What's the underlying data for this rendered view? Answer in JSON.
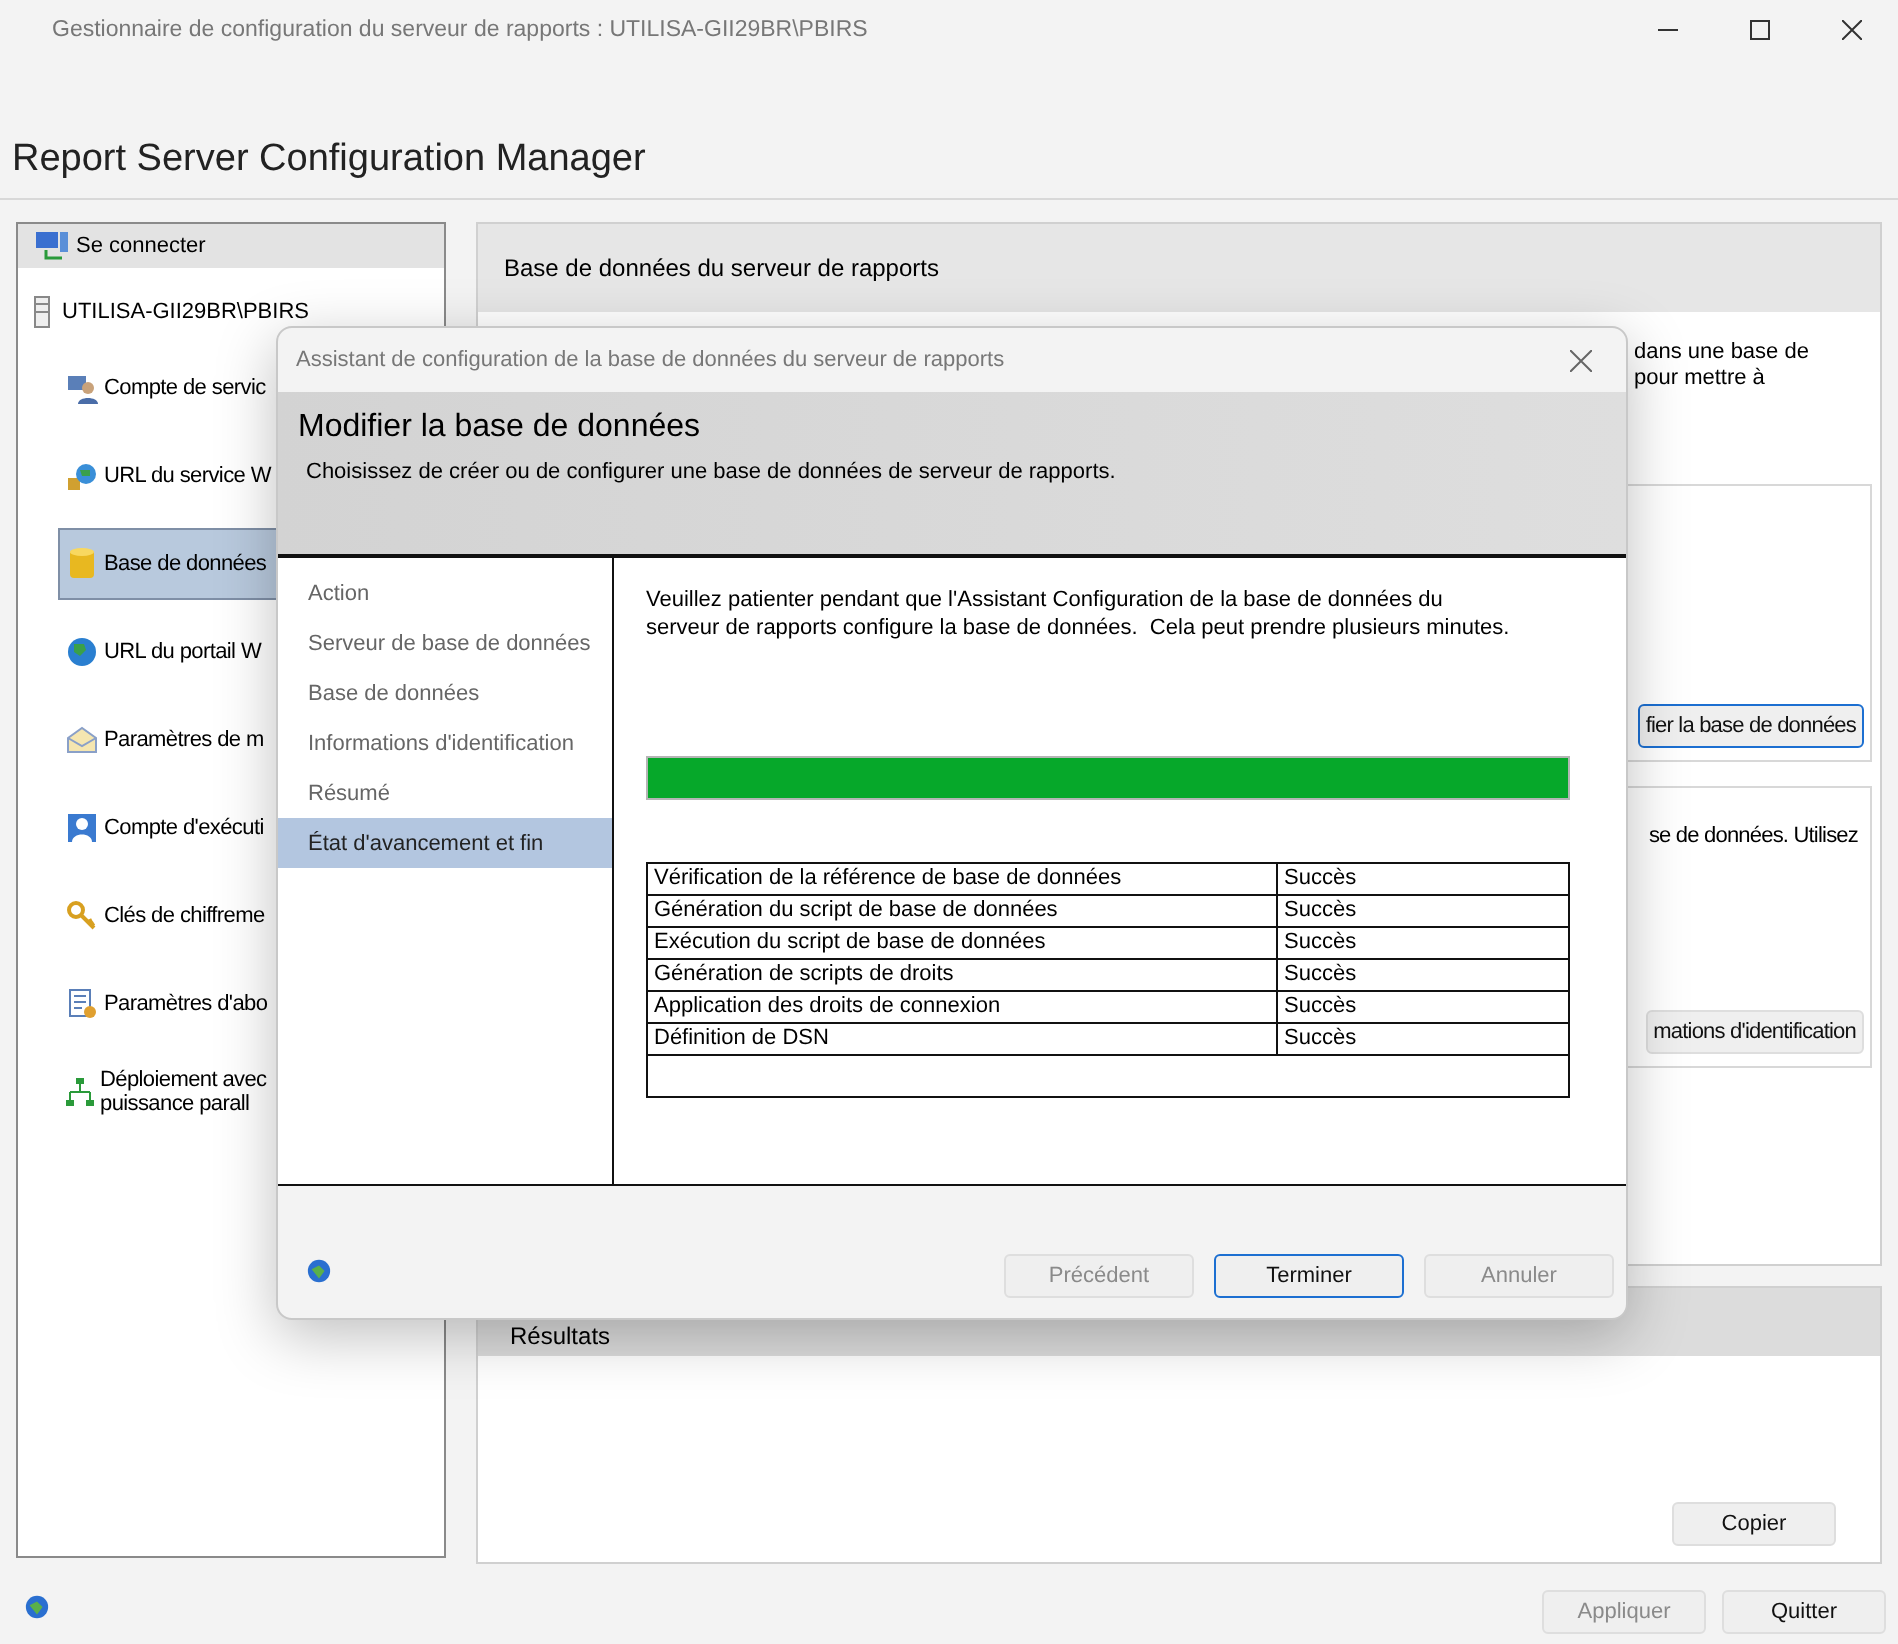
{
  "window": {
    "title": "Gestionnaire de configuration du serveur de rapports : UTILISA-GII29BR\\PBIRS"
  },
  "app_title": "Report Server Configuration Manager",
  "sidebar": {
    "connect": "Se connecter",
    "server": "UTILISA-GII29BR\\PBIRS",
    "items": [
      {
        "kind": "service",
        "label": "Compte de servic",
        "selected": false
      },
      {
        "kind": "webservice",
        "label": "URL du service W",
        "selected": false
      },
      {
        "kind": "database",
        "label": "Base de données",
        "selected": true
      },
      {
        "kind": "globe",
        "label": "URL du portail W",
        "selected": false
      },
      {
        "kind": "mail",
        "label": "Paramètres de m",
        "selected": false
      },
      {
        "kind": "account",
        "label": "Compte d'exécuti",
        "selected": false
      },
      {
        "kind": "keys",
        "label": "Clés de chiffreme",
        "selected": false
      },
      {
        "kind": "subscription",
        "label": "Paramètres d'abo",
        "selected": false
      },
      {
        "kind": "scaleout",
        "label": "Déploiement avec\npuissance parall",
        "selected": false
      }
    ]
  },
  "main_panel": {
    "title": "Base de données du serveur de rapports",
    "intro_lines": [
      "dans une base de",
      "pour mettre à"
    ],
    "change_button": "fier la base de données",
    "credentials_text": "se de données. Utilisez",
    "credentials_button": "mations d'identification"
  },
  "results": {
    "title": "Résultats",
    "copy_button": "Copier"
  },
  "footer_buttons": [
    {
      "label": "Appliquer",
      "disabled": true
    },
    {
      "label": "Quitter",
      "disabled": false
    }
  ],
  "dialog": {
    "title": "Assistant de configuration de la base de données du serveur de rapports",
    "heading": "Modifier la base de données",
    "subheading": "Choisissez de créer ou de configurer une base de données de serveur de rapports.",
    "steps": [
      {
        "label": "Action",
        "selected": false
      },
      {
        "label": "Serveur de base de données",
        "selected": false
      },
      {
        "label": "Base de données",
        "selected": false
      },
      {
        "label": "Informations d'identification",
        "selected": false
      },
      {
        "label": "Résumé",
        "selected": false
      },
      {
        "label": "État d'avancement et fin",
        "selected": true
      }
    ],
    "message": "Veuillez patienter pendant que l'Assistant Configuration de la base de données du\nserveur de rapports configure la base de données.  Cela peut prendre plusieurs minutes.",
    "progress": {
      "level": 1
    },
    "tasks": [
      {
        "task": "Vérification de la référence de base de données",
        "status": "Succès"
      },
      {
        "task": "Génération du script de base de données",
        "status": "Succès"
      },
      {
        "task": "Exécution du script de base de données",
        "status": "Succès"
      },
      {
        "task": "Génération de scripts de droits",
        "status": "Succès"
      },
      {
        "task": "Application des droits de connexion",
        "status": "Succès"
      },
      {
        "task": "Définition de DSN",
        "status": "Succès"
      }
    ],
    "buttons": [
      {
        "label": "Précédent",
        "disabled": true,
        "focused": false
      },
      {
        "label": "Terminer",
        "disabled": false,
        "focused": true
      },
      {
        "label": "Annuler",
        "disabled": true,
        "focused": false
      }
    ]
  }
}
